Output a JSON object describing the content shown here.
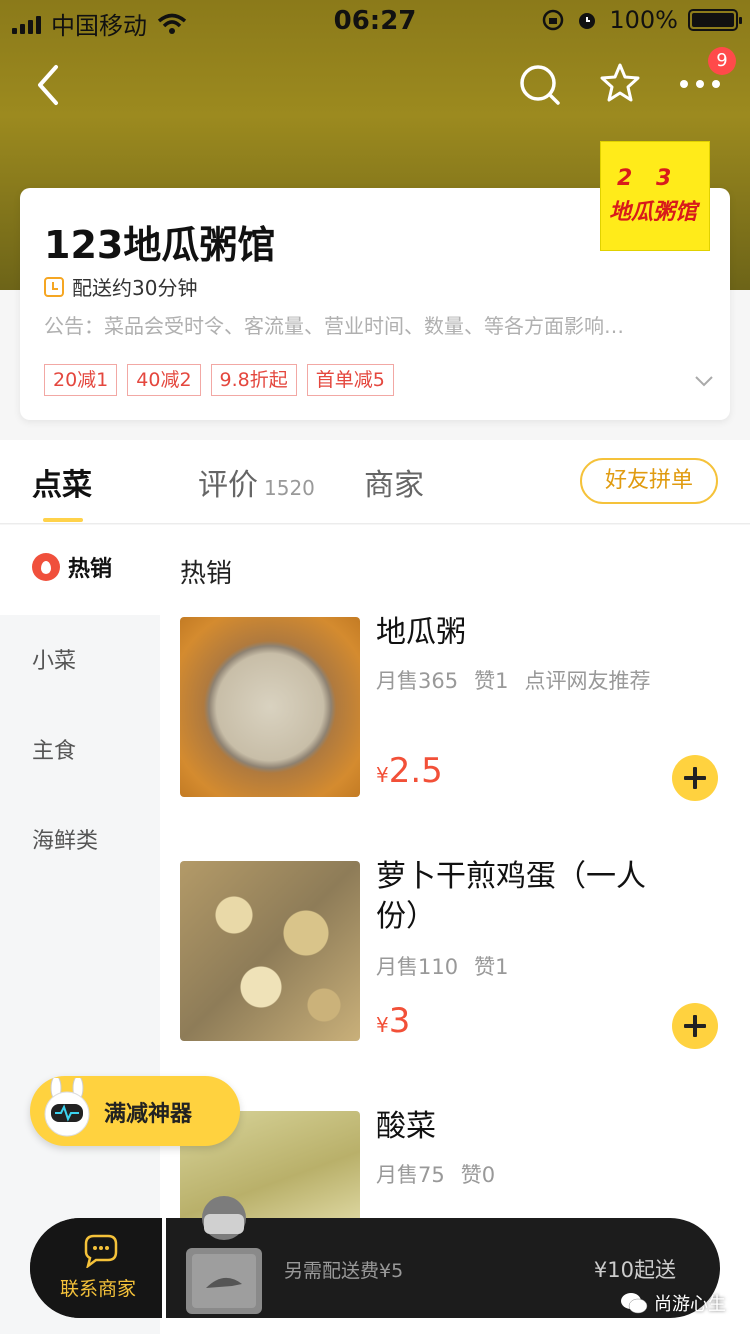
{
  "status_bar": {
    "carrier": "中国移动",
    "time": "06:27",
    "battery": "100%"
  },
  "navbar": {
    "badge_count": "9",
    "icons": [
      "back-arrow-icon",
      "search-icon",
      "star-icon",
      "more-icon"
    ]
  },
  "store": {
    "name": "123地瓜粥馆",
    "logo_line1": "2 3",
    "logo_line2": "地瓜粥馆",
    "delivery_time": "配送约30分钟",
    "notice": "公告：菜品会受时令、客流量、营业时间、数量、等各方面影响…",
    "promotions": [
      "20减1",
      "40减2",
      "9.8折起",
      "首单减5"
    ]
  },
  "tabs": {
    "order": "点菜",
    "reviews": "评价",
    "reviews_count": "1520",
    "merchant": "商家",
    "group_button": "好友拼单"
  },
  "sidebar": {
    "hot": "热销",
    "items": [
      "小菜",
      "主食",
      "海鲜类"
    ]
  },
  "section_title": "热销",
  "dishes": [
    {
      "name": "地瓜粥",
      "monthly_sales": "月售365",
      "likes": "赞1",
      "tag": "点评网友推荐",
      "currency": "¥",
      "price": "2.5"
    },
    {
      "name": "萝卜干煎鸡蛋（一人份）",
      "monthly_sales": "月售110",
      "likes": "赞1",
      "tag": "",
      "currency": "¥",
      "price": "3"
    },
    {
      "name": "酸菜",
      "monthly_sales": "月售75",
      "likes": "赞0",
      "tag": "",
      "currency": "",
      "price": ""
    }
  ],
  "promo_float": {
    "label": "满减神器"
  },
  "bottom_bar": {
    "contact_label": "联系商家",
    "delivery_fee": "另需配送费¥5",
    "minimum_order": "¥10起送"
  },
  "watermark": {
    "text": "尚游心生"
  },
  "colors": {
    "accent_yellow": "#ffd23f",
    "price_red": "#f25038",
    "promo_red": "#e4473e"
  }
}
